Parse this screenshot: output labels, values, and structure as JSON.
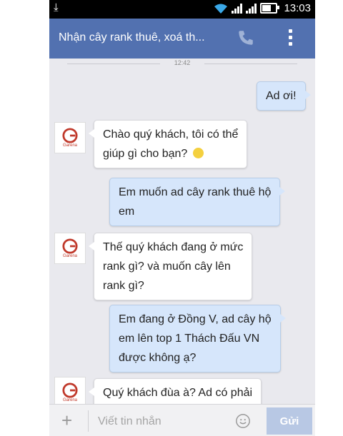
{
  "status_bar": {
    "time": "13:03"
  },
  "header": {
    "title": "Nhận cây rank thuê, xoá th..."
  },
  "conversation": {
    "timestamp": "12:42",
    "avatar_brand": "Garena",
    "messages": [
      {
        "side": "out",
        "text": "Ad ơi!"
      },
      {
        "side": "in",
        "line1": "Chào quý khách, tôi có thể",
        "line2": "giúp gì cho bạn?"
      },
      {
        "side": "out",
        "line1": "Em muốn ad cây rank thuê hộ",
        "line2": "em"
      },
      {
        "side": "in",
        "line1": "Thế quý khách đang ở mức",
        "line2": "rank gì? và muốn cây lên",
        "line3": "rank gì?"
      },
      {
        "side": "out",
        "line1": "Em đang ở Đồng V, ad cây hộ",
        "line2": "em lên top 1 Thách Đấu VN",
        "line3": "được không ạ?"
      },
      {
        "side": "in",
        "line1": "Quý khách đùa à? Ad có phải"
      }
    ]
  },
  "composer": {
    "placeholder": "Viết tin nhắn",
    "send_label": "Gửi"
  },
  "colors": {
    "header": "#5271b0",
    "outgoing_bubble": "#d6e6fb",
    "incoming_bubble": "#ffffff",
    "send_button": "#b8c8e4"
  }
}
